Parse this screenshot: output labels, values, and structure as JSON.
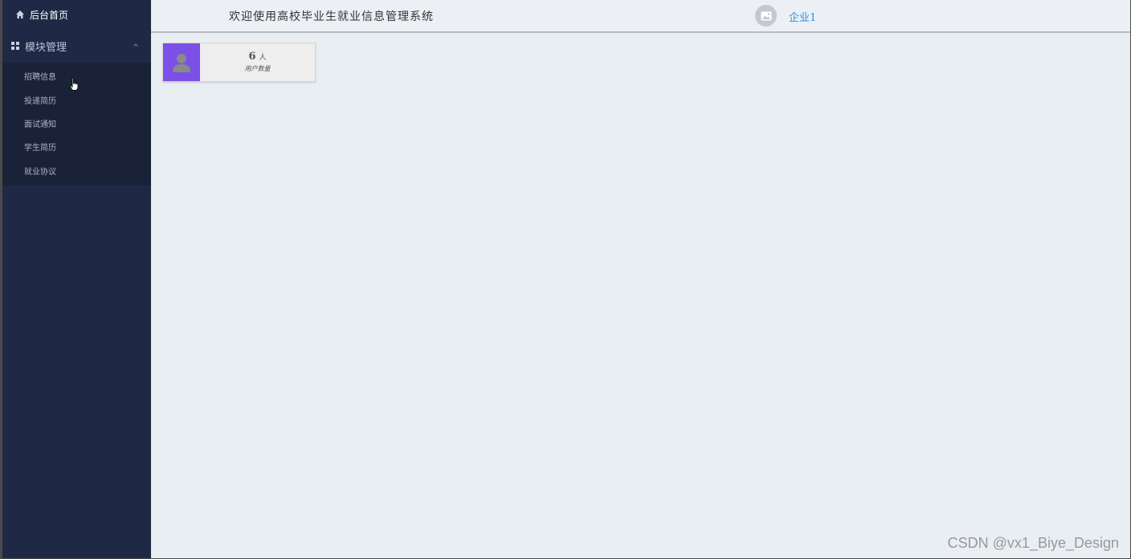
{
  "sidebar": {
    "home_label": "后台首页",
    "group": {
      "label": "模块管理",
      "expanded": true,
      "items": [
        {
          "label": "招聘信息"
        },
        {
          "label": "投递简历"
        },
        {
          "label": "面试通知"
        },
        {
          "label": "学生简历"
        },
        {
          "label": "就业协议"
        }
      ]
    }
  },
  "header": {
    "title": "欢迎使用高校毕业生就业信息管理系统",
    "user_name": "企业1",
    "avatar_icon": "image-icon"
  },
  "dashboard": {
    "stat_card": {
      "value": "6",
      "unit": "人",
      "label": "用户数量",
      "icon": "user-icon",
      "accent_color": "#7c4fe6"
    }
  },
  "watermark": "CSDN @vx1_Biye_Design",
  "colors": {
    "sidebar_bg": "#1f2945",
    "submenu_bg": "#1a2238",
    "content_bg": "#e9eef3",
    "link": "#2d8fde"
  }
}
